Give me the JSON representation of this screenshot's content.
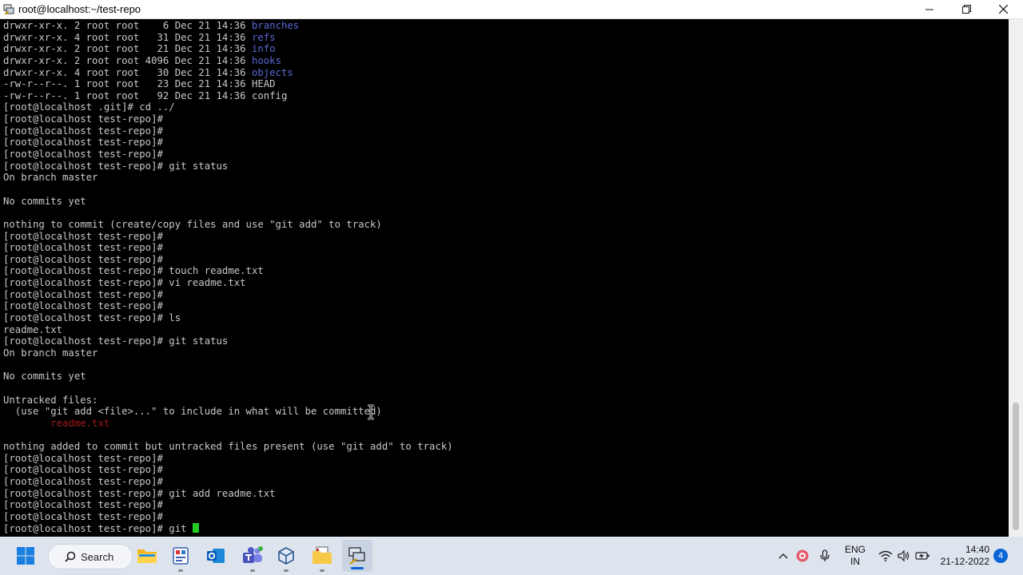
{
  "window": {
    "title": "root@localhost:~/test-repo"
  },
  "terminal": {
    "lines": [
      {
        "parts": [
          {
            "t": "drwxr-xr-x. 2 root root    6 Dec 21 14:36 "
          },
          {
            "t": "branches",
            "c": "dir"
          }
        ]
      },
      {
        "parts": [
          {
            "t": "drwxr-xr-x. 4 root root   31 Dec 21 14:36 "
          },
          {
            "t": "refs",
            "c": "dir"
          }
        ]
      },
      {
        "parts": [
          {
            "t": "drwxr-xr-x. 2 root root   21 Dec 21 14:36 "
          },
          {
            "t": "info",
            "c": "dir"
          }
        ]
      },
      {
        "parts": [
          {
            "t": "drwxr-xr-x. 2 root root 4096 Dec 21 14:36 "
          },
          {
            "t": "hooks",
            "c": "dir"
          }
        ]
      },
      {
        "parts": [
          {
            "t": "drwxr-xr-x. 4 root root   30 Dec 21 14:36 "
          },
          {
            "t": "objects",
            "c": "dir"
          }
        ]
      },
      {
        "parts": [
          {
            "t": "-rw-r--r--. 1 root root   23 Dec 21 14:36 HEAD"
          }
        ]
      },
      {
        "parts": [
          {
            "t": "-rw-r--r--. 1 root root   92 Dec 21 14:36 config"
          }
        ]
      },
      {
        "parts": [
          {
            "t": "[root@localhost .git]# cd ../"
          }
        ]
      },
      {
        "parts": [
          {
            "t": "[root@localhost test-repo]#"
          }
        ]
      },
      {
        "parts": [
          {
            "t": "[root@localhost test-repo]#"
          }
        ]
      },
      {
        "parts": [
          {
            "t": "[root@localhost test-repo]#"
          }
        ]
      },
      {
        "parts": [
          {
            "t": "[root@localhost test-repo]#"
          }
        ]
      },
      {
        "parts": [
          {
            "t": "[root@localhost test-repo]# git status"
          }
        ]
      },
      {
        "parts": [
          {
            "t": "On branch master"
          }
        ]
      },
      {
        "parts": [
          {
            "t": ""
          }
        ]
      },
      {
        "parts": [
          {
            "t": "No commits yet"
          }
        ]
      },
      {
        "parts": [
          {
            "t": ""
          }
        ]
      },
      {
        "parts": [
          {
            "t": "nothing to commit (create/copy files and use \"git add\" to track)"
          }
        ]
      },
      {
        "parts": [
          {
            "t": "[root@localhost test-repo]#"
          }
        ]
      },
      {
        "parts": [
          {
            "t": "[root@localhost test-repo]#"
          }
        ]
      },
      {
        "parts": [
          {
            "t": "[root@localhost test-repo]#"
          }
        ]
      },
      {
        "parts": [
          {
            "t": "[root@localhost test-repo]# touch readme.txt"
          }
        ]
      },
      {
        "parts": [
          {
            "t": "[root@localhost test-repo]# vi readme.txt"
          }
        ]
      },
      {
        "parts": [
          {
            "t": "[root@localhost test-repo]#"
          }
        ]
      },
      {
        "parts": [
          {
            "t": "[root@localhost test-repo]#"
          }
        ]
      },
      {
        "parts": [
          {
            "t": "[root@localhost test-repo]# ls"
          }
        ]
      },
      {
        "parts": [
          {
            "t": "readme.txt"
          }
        ]
      },
      {
        "parts": [
          {
            "t": "[root@localhost test-repo]# git status"
          }
        ]
      },
      {
        "parts": [
          {
            "t": "On branch master"
          }
        ]
      },
      {
        "parts": [
          {
            "t": ""
          }
        ]
      },
      {
        "parts": [
          {
            "t": "No commits yet"
          }
        ]
      },
      {
        "parts": [
          {
            "t": ""
          }
        ]
      },
      {
        "parts": [
          {
            "t": "Untracked files:"
          }
        ]
      },
      {
        "parts": [
          {
            "t": "  (use \"git add <file>...\" to include in what will be committed)"
          }
        ]
      },
      {
        "parts": [
          {
            "t": "        "
          },
          {
            "t": "readme.txt",
            "c": "untracked"
          }
        ]
      },
      {
        "parts": [
          {
            "t": ""
          }
        ]
      },
      {
        "parts": [
          {
            "t": "nothing added to commit but untracked files present (use \"git add\" to track)"
          }
        ]
      },
      {
        "parts": [
          {
            "t": "[root@localhost test-repo]#"
          }
        ]
      },
      {
        "parts": [
          {
            "t": "[root@localhost test-repo]#"
          }
        ]
      },
      {
        "parts": [
          {
            "t": "[root@localhost test-repo]#"
          }
        ]
      },
      {
        "parts": [
          {
            "t": "[root@localhost test-repo]# git add readme.txt"
          }
        ]
      },
      {
        "parts": [
          {
            "t": "[root@localhost test-repo]#"
          }
        ]
      },
      {
        "parts": [
          {
            "t": "[root@localhost test-repo]#"
          }
        ]
      },
      {
        "parts": [
          {
            "t": "[root@localhost test-repo]# git "
          }
        ],
        "cursor": true
      }
    ]
  },
  "taskbar": {
    "search_label": "Search",
    "language_line1": "ENG",
    "language_line2": "IN",
    "time": "14:40",
    "date": "21-12-2022",
    "notification_count": "4"
  },
  "colors": {
    "directory": "#5a6ad6",
    "untracked": "#a01818",
    "cursor": "#22cc22",
    "accent": "#0a64d8"
  }
}
